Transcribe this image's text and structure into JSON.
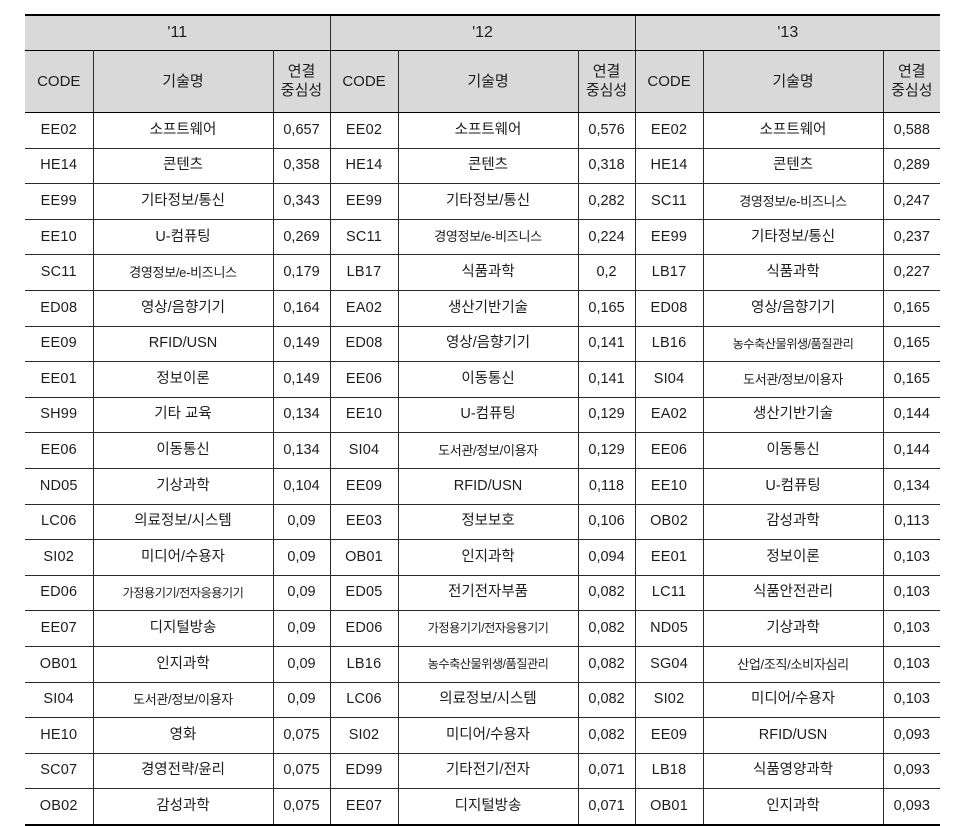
{
  "table": {
    "column_headers": {
      "code": "CODE",
      "name": "기술명",
      "value_line1": "연결",
      "value_line2": "중심성"
    },
    "groups": [
      {
        "year": "'11",
        "rows": [
          {
            "code": "EE02",
            "name": "소프트웨어",
            "value": "0,657"
          },
          {
            "code": "HE14",
            "name": "콘텐츠",
            "value": "0,358"
          },
          {
            "code": "EE99",
            "name": "기타정보/통신",
            "value": "0,343"
          },
          {
            "code": "EE10",
            "name": "U-컴퓨팅",
            "value": "0,269"
          },
          {
            "code": "SC11",
            "name": "경영정보/e-비즈니스",
            "value": "0,179"
          },
          {
            "code": "ED08",
            "name": "영상/음향기기",
            "value": "0,164"
          },
          {
            "code": "EE09",
            "name": "RFID/USN",
            "value": "0,149"
          },
          {
            "code": "EE01",
            "name": "정보이론",
            "value": "0,149"
          },
          {
            "code": "SH99",
            "name": "기타  교육",
            "value": "0,134"
          },
          {
            "code": "EE06",
            "name": "이동통신",
            "value": "0,134"
          },
          {
            "code": "ND05",
            "name": "기상과학",
            "value": "0,104"
          },
          {
            "code": "LC06",
            "name": "의료정보/시스템",
            "value": "0,09"
          },
          {
            "code": "SI02",
            "name": "미디어/수용자",
            "value": "0,09"
          },
          {
            "code": "ED06",
            "name": "가정용기기/전자응용기기",
            "value": "0,09"
          },
          {
            "code": "EE07",
            "name": "디지털방송",
            "value": "0,09"
          },
          {
            "code": "OB01",
            "name": "인지과학",
            "value": "0,09"
          },
          {
            "code": "SI04",
            "name": "도서관/정보/이용자",
            "value": "0,09"
          },
          {
            "code": "HE10",
            "name": "영화",
            "value": "0,075"
          },
          {
            "code": "SC07",
            "name": "경영전략/윤리",
            "value": "0,075"
          },
          {
            "code": "OB02",
            "name": "감성과학",
            "value": "0,075"
          }
        ]
      },
      {
        "year": "'12",
        "rows": [
          {
            "code": "EE02",
            "name": "소프트웨어",
            "value": "0,576"
          },
          {
            "code": "HE14",
            "name": "콘텐츠",
            "value": "0,318"
          },
          {
            "code": "EE99",
            "name": "기타정보/통신",
            "value": "0,282"
          },
          {
            "code": "SC11",
            "name": "경영정보/e-비즈니스",
            "value": "0,224"
          },
          {
            "code": "LB17",
            "name": "식품과학",
            "value": "0,2"
          },
          {
            "code": "EA02",
            "name": "생산기반기술",
            "value": "0,165"
          },
          {
            "code": "ED08",
            "name": "영상/음향기기",
            "value": "0,141"
          },
          {
            "code": "EE06",
            "name": "이동통신",
            "value": "0,141"
          },
          {
            "code": "EE10",
            "name": "U-컴퓨팅",
            "value": "0,129"
          },
          {
            "code": "SI04",
            "name": "도서관/정보/이용자",
            "value": "0,129"
          },
          {
            "code": "EE09",
            "name": "RFID/USN",
            "value": "0,118"
          },
          {
            "code": "EE03",
            "name": "정보보호",
            "value": "0,106"
          },
          {
            "code": "OB01",
            "name": "인지과학",
            "value": "0,094"
          },
          {
            "code": "ED05",
            "name": "전기전자부품",
            "value": "0,082"
          },
          {
            "code": "ED06",
            "name": "가정용기기/전자응용기기",
            "value": "0,082"
          },
          {
            "code": "LB16",
            "name": "농수축산물위생/품질관리",
            "value": "0,082"
          },
          {
            "code": "LC06",
            "name": "의료정보/시스템",
            "value": "0,082"
          },
          {
            "code": "SI02",
            "name": "미디어/수용자",
            "value": "0,082"
          },
          {
            "code": "ED99",
            "name": "기타전기/전자",
            "value": "0,071"
          },
          {
            "code": "EE07",
            "name": "디지털방송",
            "value": "0,071"
          }
        ]
      },
      {
        "year": "'13",
        "rows": [
          {
            "code": "EE02",
            "name": "소프트웨어",
            "value": "0,588"
          },
          {
            "code": "HE14",
            "name": "콘텐츠",
            "value": "0,289"
          },
          {
            "code": "SC11",
            "name": "경영정보/e-비즈니스",
            "value": "0,247"
          },
          {
            "code": "EE99",
            "name": "기타정보/통신",
            "value": "0,237"
          },
          {
            "code": "LB17",
            "name": "식품과학",
            "value": "0,227"
          },
          {
            "code": "ED08",
            "name": "영상/음향기기",
            "value": "0,165"
          },
          {
            "code": "LB16",
            "name": "농수축산물위생/품질관리",
            "value": "0,165"
          },
          {
            "code": "SI04",
            "name": "도서관/정보/이용자",
            "value": "0,165"
          },
          {
            "code": "EA02",
            "name": "생산기반기술",
            "value": "0,144"
          },
          {
            "code": "EE06",
            "name": "이동통신",
            "value": "0,144"
          },
          {
            "code": "EE10",
            "name": "U-컴퓨팅",
            "value": "0,134"
          },
          {
            "code": "OB02",
            "name": "감성과학",
            "value": "0,113"
          },
          {
            "code": "EE01",
            "name": "정보이론",
            "value": "0,103"
          },
          {
            "code": "LC11",
            "name": "식품안전관리",
            "value": "0,103"
          },
          {
            "code": "ND05",
            "name": "기상과학",
            "value": "0,103"
          },
          {
            "code": "SG04",
            "name": "산업/조직/소비자심리",
            "value": "0,103"
          },
          {
            "code": "SI02",
            "name": "미디어/수용자",
            "value": "0,103"
          },
          {
            "code": "EE09",
            "name": "RFID/USN",
            "value": "0,093"
          },
          {
            "code": "LB18",
            "name": "식품영양과학",
            "value": "0,093"
          },
          {
            "code": "OB01",
            "name": "인지과학",
            "value": "0,093"
          }
        ]
      }
    ]
  }
}
